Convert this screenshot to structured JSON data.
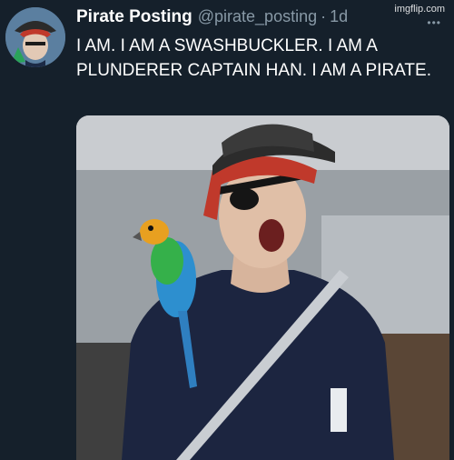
{
  "tweet": {
    "display_name": "Pirate Posting",
    "handle": "@pirate_posting",
    "separator": "·",
    "time": "1d",
    "text": "I AM. I AM A SWASHBUCKLER. I AM A PLUNDERER CAPTAIN HAN. I AM A PIRATE.",
    "more_label": "•••",
    "avatar_icon": "pirate-avatar",
    "media_icon": "pirate-doctor-meme-photo"
  },
  "watermark": "imgflip.com",
  "colors": {
    "background": "#15202b",
    "secondary_text": "#8899a6",
    "primary_text": "#ffffff"
  }
}
